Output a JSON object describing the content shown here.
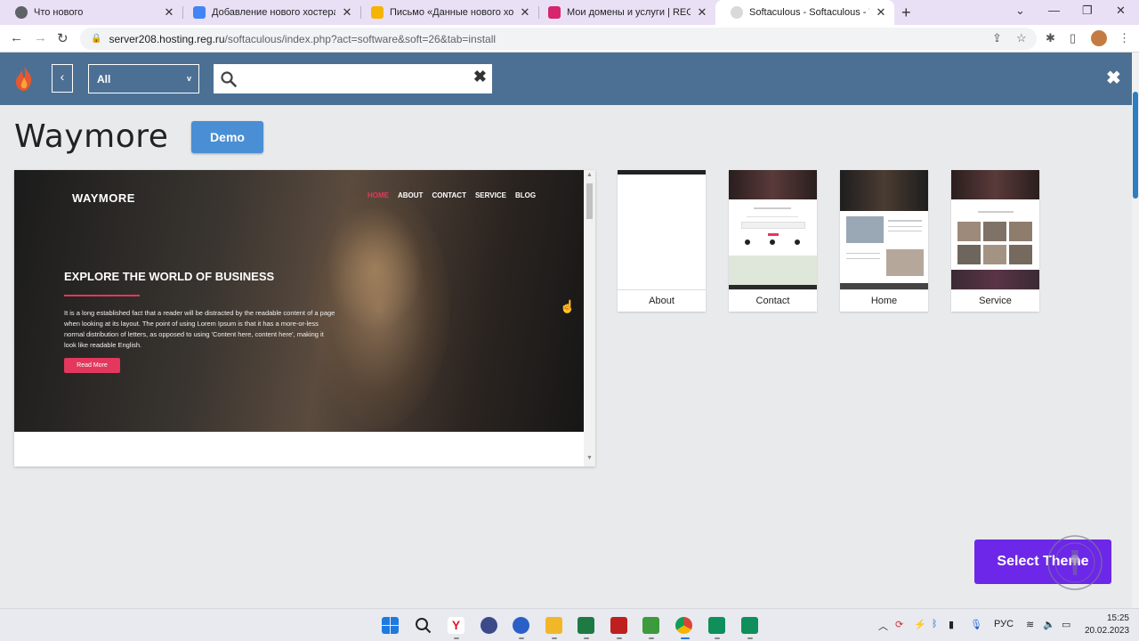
{
  "browser": {
    "tabs": [
      {
        "title": "Что нового",
        "color": "#5f6368"
      },
      {
        "title": "Добавление нового хостера на",
        "color": "#4285f4"
      },
      {
        "title": "Письмо «Данные нового хостинга",
        "color": "#f4b400"
      },
      {
        "title": "Мои домены и услуги | REG.RU",
        "color": "#d6246e"
      },
      {
        "title": "Softaculous - Softaculous - WordPress",
        "color": "#7a7a7a",
        "active": true
      }
    ],
    "url_host": "server208.hosting.reg.ru",
    "url_path": "/softaculous/index.php?act=software&soft=26&tab=install"
  },
  "softaculous": {
    "category_selected": "All",
    "search_placeholder": ""
  },
  "theme": {
    "name": "Waymore",
    "demo_label": "Demo",
    "preview": {
      "logo": "WAYMORE",
      "nav": [
        "HOME",
        "ABOUT",
        "CONTACT",
        "SERVICE",
        "BLOG"
      ],
      "heading": "EXPLORE THE WORLD OF BUSINESS",
      "paragraph": "It is a long established fact that a reader will be distracted by the readable content of a page when looking at its layout. The point of using Lorem Ipsum is that it has a more-or-less normal distribution of letters, as opposed to using 'Content here, content here', making it look like readable English.",
      "button": "Read More"
    },
    "pages": [
      "About",
      "Contact",
      "Home",
      "Service"
    ],
    "select_label": "Select Theme"
  },
  "taskbar": {
    "language": "РУС",
    "time": "15:25",
    "date": "20.02.2023"
  },
  "colors": {
    "accent": "#e2385d",
    "header": "#4c7094",
    "select_button": "#6d27e8",
    "demo_button": "#4a8fd4"
  }
}
